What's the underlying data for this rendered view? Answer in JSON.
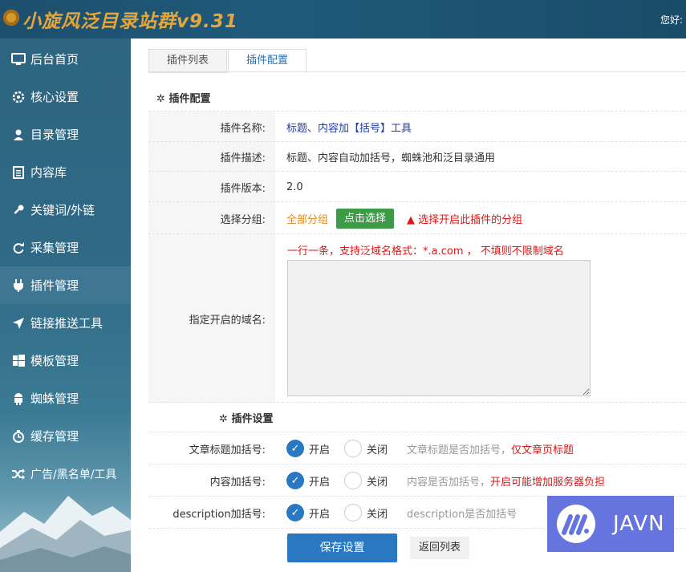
{
  "header": {
    "title": "小旋风泛目录站群v9.31",
    "greeting": "您好:"
  },
  "sidebar": {
    "items": [
      {
        "label": "后台首页",
        "icon": "monitor-icon"
      },
      {
        "label": "核心设置",
        "icon": "gear-icon"
      },
      {
        "label": "目录管理",
        "icon": "user-icon"
      },
      {
        "label": "内容库",
        "icon": "list-icon"
      },
      {
        "label": "关键词/外链",
        "icon": "key-icon"
      },
      {
        "label": "采集管理",
        "icon": "refresh-icon"
      },
      {
        "label": "插件管理",
        "icon": "plug-icon"
      },
      {
        "label": "链接推送工具",
        "icon": "send-icon"
      },
      {
        "label": "模板管理",
        "icon": "windows-icon"
      },
      {
        "label": "蜘蛛管理",
        "icon": "android-icon"
      },
      {
        "label": "缓存管理",
        "icon": "timer-icon"
      },
      {
        "label": "广告/黑名单/工具",
        "icon": "shuffle-icon"
      }
    ],
    "active_index": 6
  },
  "tabs": [
    {
      "label": "插件列表"
    },
    {
      "label": "插件配置"
    }
  ],
  "config": {
    "section_title": "插件配置",
    "name_label": "插件名称:",
    "name_value": "标题、内容加【括号】工具",
    "desc_label": "插件描述:",
    "desc_value": "标题、内容自动加括号，蜘蛛池和泛目录通用",
    "version_label": "插件版本:",
    "version_value": "2.0",
    "group_label": "选择分组:",
    "group_value": "全部分组",
    "group_button": "点击选择",
    "group_warning": "选择开启此插件的分组",
    "domain_label": "指定开启的域名:",
    "domain_hint": "一行一条，支持泛域名格式：*.a.com ， 不填则不限制域名",
    "domain_value": ""
  },
  "settings": {
    "section_title": "插件设置",
    "on_label": "开启",
    "off_label": "关闭",
    "rows": [
      {
        "label": "文章标题加括号:",
        "hint": "文章标题是否加括号，",
        "hint_red": "仅文章页标题",
        "on": true
      },
      {
        "label": "内容加括号:",
        "hint": "内容是否加括号，",
        "hint_red": "开启可能增加服务器负担",
        "on": true
      },
      {
        "label": "description加括号:",
        "hint": "description是否加括号",
        "hint_red": "",
        "on": true
      }
    ]
  },
  "buttons": {
    "save": "保存设置",
    "back": "返回列表"
  },
  "watermark": {
    "text": "JAVN"
  }
}
